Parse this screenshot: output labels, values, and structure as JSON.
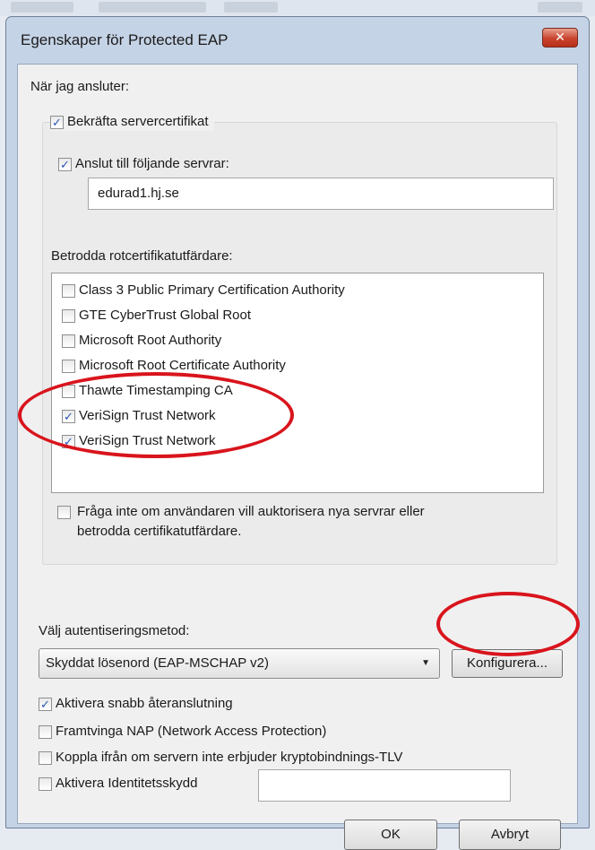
{
  "dialog": {
    "title": "Egenskaper för Protected EAP",
    "close_label": "✕",
    "connect_label": "När jag ansluter:",
    "verify_cert": {
      "label": "Bekräfta servercertifikat",
      "checked": true
    },
    "connect_servers": {
      "label": "Anslut till följande servrar:",
      "checked": true,
      "value": "edurad1.hj.se"
    },
    "trusted_ca_label": "Betrodda rotcertifikatutfärdare:",
    "ca_list": [
      {
        "label": "Class 3 Public Primary Certification Authority",
        "checked": false
      },
      {
        "label": "GTE CyberTrust Global Root",
        "checked": false
      },
      {
        "label": "Microsoft Root Authority",
        "checked": false
      },
      {
        "label": "Microsoft Root Certificate Authority",
        "checked": false
      },
      {
        "label": "Thawte Timestamping CA",
        "checked": false
      },
      {
        "label": "VeriSign Trust Network",
        "checked": true
      },
      {
        "label": "VeriSign Trust Network",
        "checked": true
      }
    ],
    "dont_prompt": {
      "label_line1": "Fråga inte om användaren vill auktorisera nya servrar eller",
      "label_line2": "betrodda certifikatutfärdare.",
      "checked": false
    },
    "auth_method_label": "Välj autentiseringsmetod:",
    "auth_method_value": "Skyddat lösenord (EAP-MSCHAP v2)",
    "configure_label": "Konfigurera...",
    "fast_reconnect": {
      "label": "Aktivera snabb återanslutning",
      "checked": true
    },
    "enforce_nap": {
      "label": "Framtvinga NAP (Network Access Protection)",
      "checked": false
    },
    "disconnect_tlv": {
      "label": "Koppla ifrån om servern inte erbjuder kryptobindnings-TLV",
      "checked": false
    },
    "identity_privacy": {
      "label": "Aktivera Identitetsskydd",
      "checked": false,
      "value": ""
    },
    "ok_label": "OK",
    "cancel_label": "Avbryt"
  },
  "colors": {
    "highlight_circle": "#d9141c",
    "checkmark": "#2b55b8"
  }
}
